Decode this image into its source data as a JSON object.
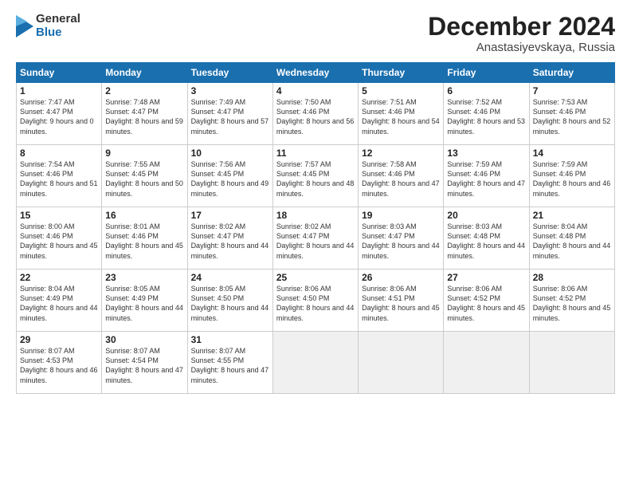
{
  "header": {
    "logo_general": "General",
    "logo_blue": "Blue",
    "month_title": "December 2024",
    "location": "Anastasiyevskaya, Russia"
  },
  "days_of_week": [
    "Sunday",
    "Monday",
    "Tuesday",
    "Wednesday",
    "Thursday",
    "Friday",
    "Saturday"
  ],
  "weeks": [
    [
      {
        "day": 1,
        "sunrise": "7:47 AM",
        "sunset": "4:47 PM",
        "daylight": "9 hours and 0 minutes."
      },
      {
        "day": 2,
        "sunrise": "7:48 AM",
        "sunset": "4:47 PM",
        "daylight": "8 hours and 59 minutes."
      },
      {
        "day": 3,
        "sunrise": "7:49 AM",
        "sunset": "4:47 PM",
        "daylight": "8 hours and 57 minutes."
      },
      {
        "day": 4,
        "sunrise": "7:50 AM",
        "sunset": "4:46 PM",
        "daylight": "8 hours and 56 minutes."
      },
      {
        "day": 5,
        "sunrise": "7:51 AM",
        "sunset": "4:46 PM",
        "daylight": "8 hours and 54 minutes."
      },
      {
        "day": 6,
        "sunrise": "7:52 AM",
        "sunset": "4:46 PM",
        "daylight": "8 hours and 53 minutes."
      },
      {
        "day": 7,
        "sunrise": "7:53 AM",
        "sunset": "4:46 PM",
        "daylight": "8 hours and 52 minutes."
      }
    ],
    [
      {
        "day": 8,
        "sunrise": "7:54 AM",
        "sunset": "4:46 PM",
        "daylight": "8 hours and 51 minutes."
      },
      {
        "day": 9,
        "sunrise": "7:55 AM",
        "sunset": "4:45 PM",
        "daylight": "8 hours and 50 minutes."
      },
      {
        "day": 10,
        "sunrise": "7:56 AM",
        "sunset": "4:45 PM",
        "daylight": "8 hours and 49 minutes."
      },
      {
        "day": 11,
        "sunrise": "7:57 AM",
        "sunset": "4:45 PM",
        "daylight": "8 hours and 48 minutes."
      },
      {
        "day": 12,
        "sunrise": "7:58 AM",
        "sunset": "4:46 PM",
        "daylight": "8 hours and 47 minutes."
      },
      {
        "day": 13,
        "sunrise": "7:59 AM",
        "sunset": "4:46 PM",
        "daylight": "8 hours and 47 minutes."
      },
      {
        "day": 14,
        "sunrise": "7:59 AM",
        "sunset": "4:46 PM",
        "daylight": "8 hours and 46 minutes."
      }
    ],
    [
      {
        "day": 15,
        "sunrise": "8:00 AM",
        "sunset": "4:46 PM",
        "daylight": "8 hours and 45 minutes."
      },
      {
        "day": 16,
        "sunrise": "8:01 AM",
        "sunset": "4:46 PM",
        "daylight": "8 hours and 45 minutes."
      },
      {
        "day": 17,
        "sunrise": "8:02 AM",
        "sunset": "4:47 PM",
        "daylight": "8 hours and 44 minutes."
      },
      {
        "day": 18,
        "sunrise": "8:02 AM",
        "sunset": "4:47 PM",
        "daylight": "8 hours and 44 minutes."
      },
      {
        "day": 19,
        "sunrise": "8:03 AM",
        "sunset": "4:47 PM",
        "daylight": "8 hours and 44 minutes."
      },
      {
        "day": 20,
        "sunrise": "8:03 AM",
        "sunset": "4:48 PM",
        "daylight": "8 hours and 44 minutes."
      },
      {
        "day": 21,
        "sunrise": "8:04 AM",
        "sunset": "4:48 PM",
        "daylight": "8 hours and 44 minutes."
      }
    ],
    [
      {
        "day": 22,
        "sunrise": "8:04 AM",
        "sunset": "4:49 PM",
        "daylight": "8 hours and 44 minutes."
      },
      {
        "day": 23,
        "sunrise": "8:05 AM",
        "sunset": "4:49 PM",
        "daylight": "8 hours and 44 minutes."
      },
      {
        "day": 24,
        "sunrise": "8:05 AM",
        "sunset": "4:50 PM",
        "daylight": "8 hours and 44 minutes."
      },
      {
        "day": 25,
        "sunrise": "8:06 AM",
        "sunset": "4:50 PM",
        "daylight": "8 hours and 44 minutes."
      },
      {
        "day": 26,
        "sunrise": "8:06 AM",
        "sunset": "4:51 PM",
        "daylight": "8 hours and 45 minutes."
      },
      {
        "day": 27,
        "sunrise": "8:06 AM",
        "sunset": "4:52 PM",
        "daylight": "8 hours and 45 minutes."
      },
      {
        "day": 28,
        "sunrise": "8:06 AM",
        "sunset": "4:52 PM",
        "daylight": "8 hours and 45 minutes."
      }
    ],
    [
      {
        "day": 29,
        "sunrise": "8:07 AM",
        "sunset": "4:53 PM",
        "daylight": "8 hours and 46 minutes."
      },
      {
        "day": 30,
        "sunrise": "8:07 AM",
        "sunset": "4:54 PM",
        "daylight": "8 hours and 47 minutes."
      },
      {
        "day": 31,
        "sunrise": "8:07 AM",
        "sunset": "4:55 PM",
        "daylight": "8 hours and 47 minutes."
      },
      null,
      null,
      null,
      null
    ]
  ]
}
